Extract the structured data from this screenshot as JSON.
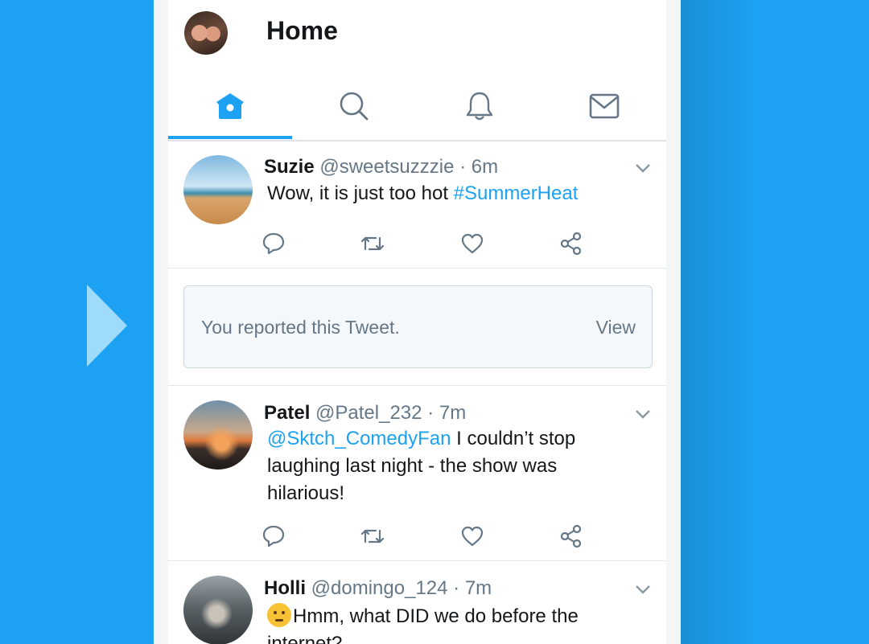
{
  "header": {
    "title": "Home"
  },
  "tabs": [
    {
      "name": "home",
      "icon": "home-icon",
      "active": true
    },
    {
      "name": "search",
      "icon": "search-icon",
      "active": false
    },
    {
      "name": "notifications",
      "icon": "bell-icon",
      "active": false
    },
    {
      "name": "messages",
      "icon": "mail-icon",
      "active": false
    }
  ],
  "tweets": [
    {
      "name": "Suzie",
      "handle": "@sweetsuzzzie",
      "time": "· 6m",
      "text_before": "Wow, it is just too hot ",
      "link": "#SummerHeat",
      "text_after": ""
    },
    {
      "name": "Patel",
      "handle": "@Patel_232",
      "time": "· 7m",
      "link": "@Sktch_ComedyFan",
      "text_after": " I couldn’t stop laughing last night - the show was hilarious!"
    },
    {
      "name": "Holli",
      "handle": "@domingo_124",
      "time": "· 7m",
      "emoji": "thinking-face",
      "text_after": "Hmm, what DID we do before the internet?"
    }
  ],
  "report": {
    "message": "You reported this Tweet.",
    "action": "View"
  },
  "colors": {
    "accent": "#1da1f2",
    "background": "#1da1f2",
    "pointer": "#9fdcfb"
  }
}
